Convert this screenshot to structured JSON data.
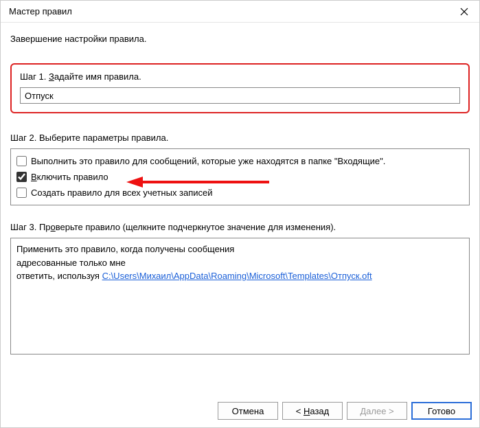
{
  "window": {
    "title": "Мастер правил"
  },
  "heading": "Завершение настройки правила.",
  "step1": {
    "label_prefix": "Шаг 1. ",
    "label_accel": "З",
    "label_rest": "адайте имя правила.",
    "value": "Отпуск"
  },
  "step2": {
    "label": "Шаг 2. Выберите параметры правила.",
    "opt_run": {
      "checked": false,
      "text": "Выполнить это правило для сообщений, которые уже находятся в папке \"Входящие\"."
    },
    "opt_enable": {
      "checked": true,
      "accel": "В",
      "rest": "ключить правило"
    },
    "opt_all_accounts": {
      "checked": false,
      "text": "Создать правило для всех учетных записей"
    }
  },
  "step3": {
    "label_prefix": "Шаг 3. Пр",
    "label_accel": "о",
    "label_rest": "верьте правило (щелкните подчеркнутое значение для изменения).",
    "line1": "Применить это правило, когда получены сообщения",
    "line2": "адресованные только мне",
    "line3_prefix": "ответить, используя ",
    "line3_link": "C:\\Users\\Михаил\\AppData\\Roaming\\Microsoft\\Templates\\Отпуск.oft"
  },
  "buttons": {
    "cancel": "Отмена",
    "back_prefix": "< ",
    "back_accel": "Н",
    "back_rest": "азад",
    "next_accel": "Д",
    "next_rest": "алее >",
    "finish": "Готово"
  }
}
